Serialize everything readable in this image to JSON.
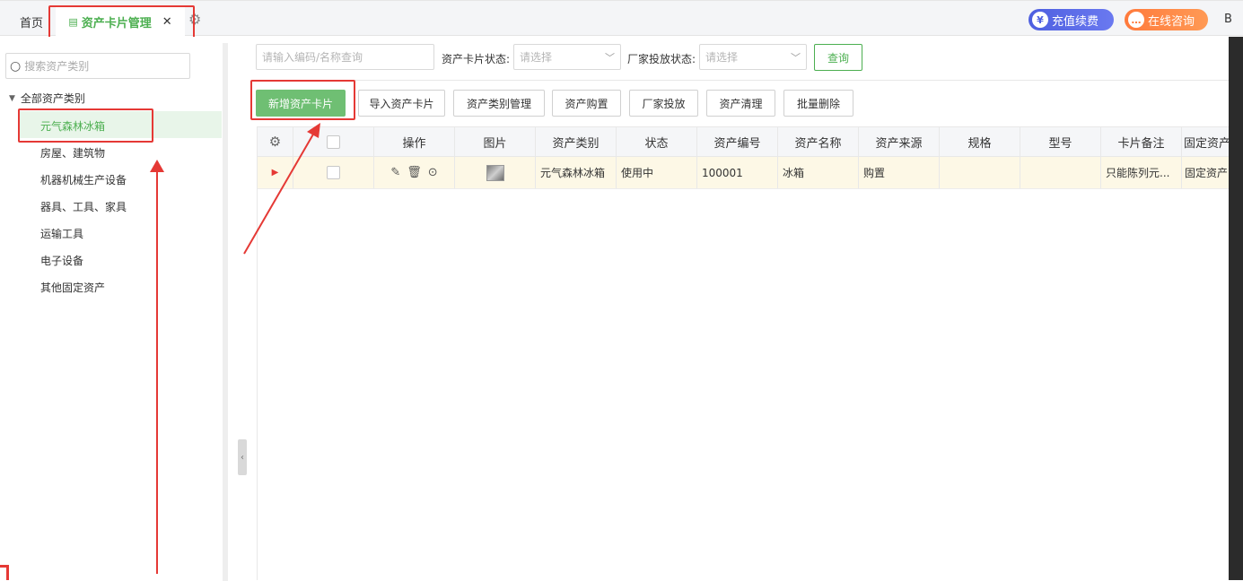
{
  "topbar": {
    "home_tab": "首页",
    "active_tab": "资产卡片管理",
    "close_glyph": "✕",
    "recharge": "充值续费",
    "consult": "在线咨询",
    "right_cut": "B"
  },
  "sidebar": {
    "search_placeholder": "搜索资产类别",
    "root": "全部资产类别",
    "items": [
      "元气森林冰箱",
      "房屋、建筑物",
      "机器机械生产设备",
      "器具、工具、家具",
      "运输工具",
      "电子设备",
      "其他固定资产"
    ]
  },
  "filters": {
    "search_placeholder": "请输入编码/名称查询",
    "card_status_label": "资产卡片状态:",
    "card_status_placeholder": "请选择",
    "vendor_status_label": "厂家投放状态:",
    "vendor_status_placeholder": "请选择",
    "query": "查询"
  },
  "toolbar": {
    "add": "新增资产卡片",
    "import": "导入资产卡片",
    "category_manage": "资产类别管理",
    "purchase": "资产购置",
    "vendor_place": "厂家投放",
    "clear": "资产清理",
    "batch_delete": "批量删除"
  },
  "table": {
    "columns": [
      "操作",
      "图片",
      "资产类别",
      "状态",
      "资产编号",
      "资产名称",
      "资产来源",
      "规格",
      "型号",
      "卡片备注",
      "固定资产"
    ],
    "rows": [
      {
        "category": "元气森林冰箱",
        "status": "使用中",
        "code": "100001",
        "name": "冰箱",
        "source": "购置",
        "spec": "",
        "model": "",
        "remark": "只能陈列元...",
        "fixed": "固定资产"
      }
    ]
  },
  "colors": {
    "accent": "#4caf50",
    "primary_button": "#6fbf73",
    "annotation": "#e53935",
    "recharge_pill": "#4e5fe0",
    "consult_pill": "#ff7a3c"
  }
}
